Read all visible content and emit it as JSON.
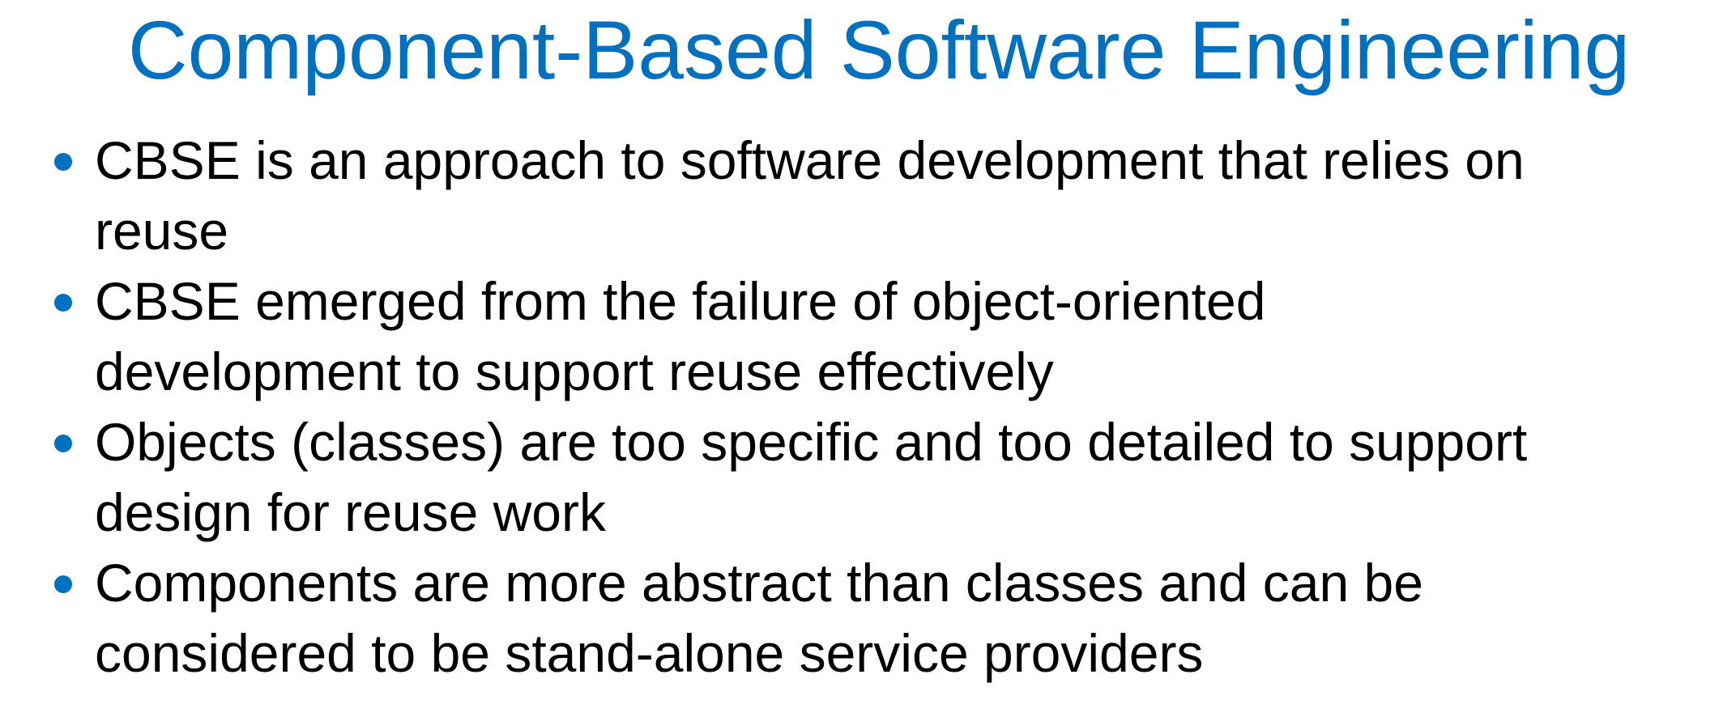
{
  "slide": {
    "title": "Component-Based Software Engineering",
    "bullets": [
      {
        "lines": [
          "CBSE is an approach to software development that relies on",
          "reuse"
        ]
      },
      {
        "lines": [
          "CBSE emerged from the failure of object-oriented",
          "development to support reuse effectively"
        ]
      },
      {
        "lines": [
          "Objects (classes) are too specific and too detailed to support",
          "design for reuse work"
        ]
      },
      {
        "lines": [
          "Components are more abstract than classes and can be",
          "considered to be stand-alone service providers"
        ]
      }
    ]
  },
  "colors": {
    "accent": "#0070c0",
    "text": "#000000",
    "background": "#ffffff"
  },
  "icons": {
    "bullet": "bullet-dot-icon"
  }
}
